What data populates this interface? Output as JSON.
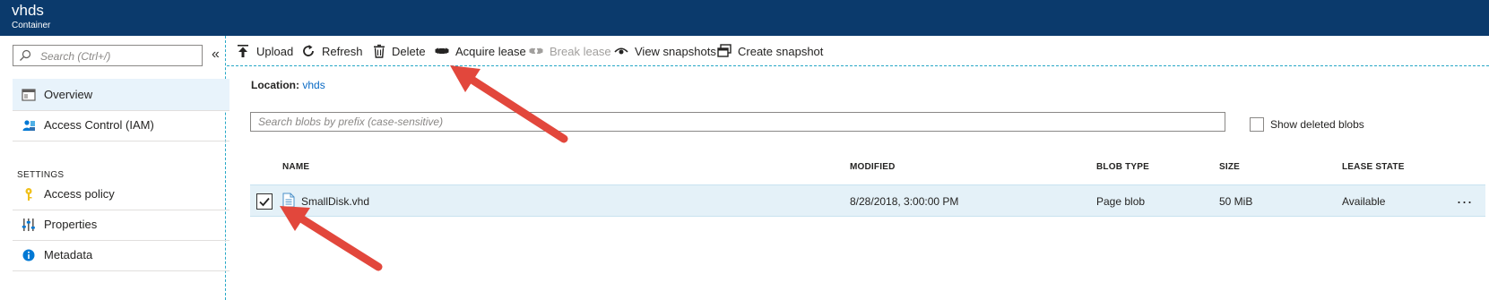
{
  "header": {
    "title": "vhds",
    "subtitle": "Container"
  },
  "sidebar": {
    "search_placeholder": "Search (Ctrl+/)",
    "collapse_glyph": "«",
    "items": [
      {
        "label": "Overview",
        "icon": "overview-icon"
      },
      {
        "label": "Access Control (IAM)",
        "icon": "iam-icon"
      }
    ],
    "section": "SETTINGS",
    "settings_items": [
      {
        "label": "Access policy",
        "icon": "key-icon"
      },
      {
        "label": "Properties",
        "icon": "properties-icon"
      },
      {
        "label": "Metadata",
        "icon": "info-icon"
      }
    ]
  },
  "toolbar": {
    "upload": "Upload",
    "refresh": "Refresh",
    "delete": "Delete",
    "acquire_lease": "Acquire lease",
    "break_lease": "Break lease",
    "view_snapshots": "View snapshots",
    "create_snapshot": "Create snapshot"
  },
  "location": {
    "label": "Location:",
    "value": "vhds"
  },
  "blob_search": {
    "placeholder": "Search blobs by prefix (case-sensitive)"
  },
  "show_deleted": {
    "label": "Show deleted blobs",
    "checked": false
  },
  "table": {
    "columns": [
      "NAME",
      "MODIFIED",
      "BLOB TYPE",
      "SIZE",
      "LEASE STATE"
    ],
    "rows": [
      {
        "name": "SmallDisk.vhd",
        "modified": "8/28/2018, 3:00:00 PM",
        "blob_type": "Page blob",
        "size": "50 MiB",
        "lease_state": "Available",
        "selected": true
      }
    ],
    "more_glyph": "..."
  },
  "colors": {
    "header_bg": "#0b3a6c",
    "accent": "#0a6ac4",
    "selected_row": "#e4f1f8",
    "annotation_arrow": "#e2473c"
  }
}
